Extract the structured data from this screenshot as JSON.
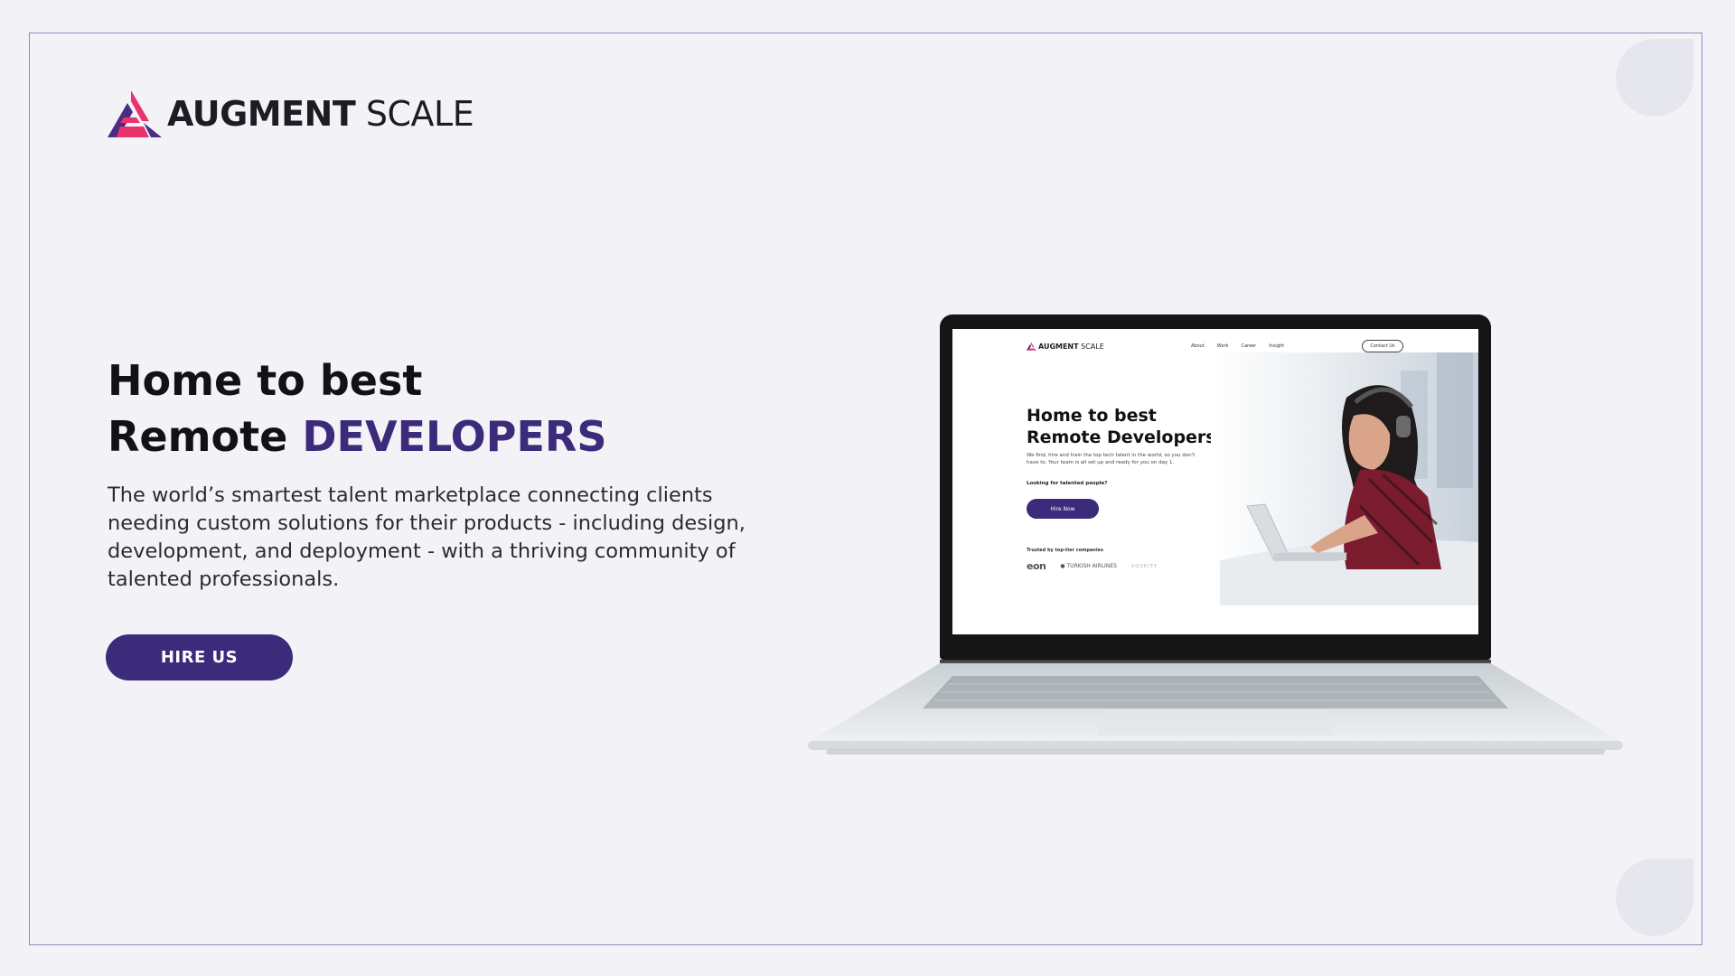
{
  "brand": {
    "name_bold": "AUGMENT",
    "name_light": "SCALE",
    "accent_color": "#3c2a7a",
    "logo_colors": [
      "#e8336b",
      "#4b2d83"
    ]
  },
  "hero": {
    "title_line1": "Home to best",
    "title_line2_prefix": "Remote",
    "title_line2_accent": "DEVELOPERS",
    "description": "The world’s smartest talent marketplace connecting clients needing custom solutions for their products - including design, development, and deployment - with a thriving community of talented professionals.",
    "cta_label": "HIRE US"
  },
  "laptop_screen": {
    "logo_bold": "AUGMENT",
    "logo_light": "SCALE",
    "nav": [
      "About",
      "Work",
      "Career",
      "Insight"
    ],
    "contact_label": "Contact Us",
    "title_line1": "Home to best",
    "title_line2": "Remote Developers",
    "subtitle": "We find, hire and train the top tech talent in the world, so you don't have to. Your team is all set up and ready for you on day 1.",
    "looking_label": "Looking for talented people?",
    "hire_label": "Hire Now",
    "trusted_label": "Trusted by top-tier companies",
    "company_logos": [
      "eon",
      "TURKISH AIRLINES",
      "VOURITY"
    ]
  }
}
